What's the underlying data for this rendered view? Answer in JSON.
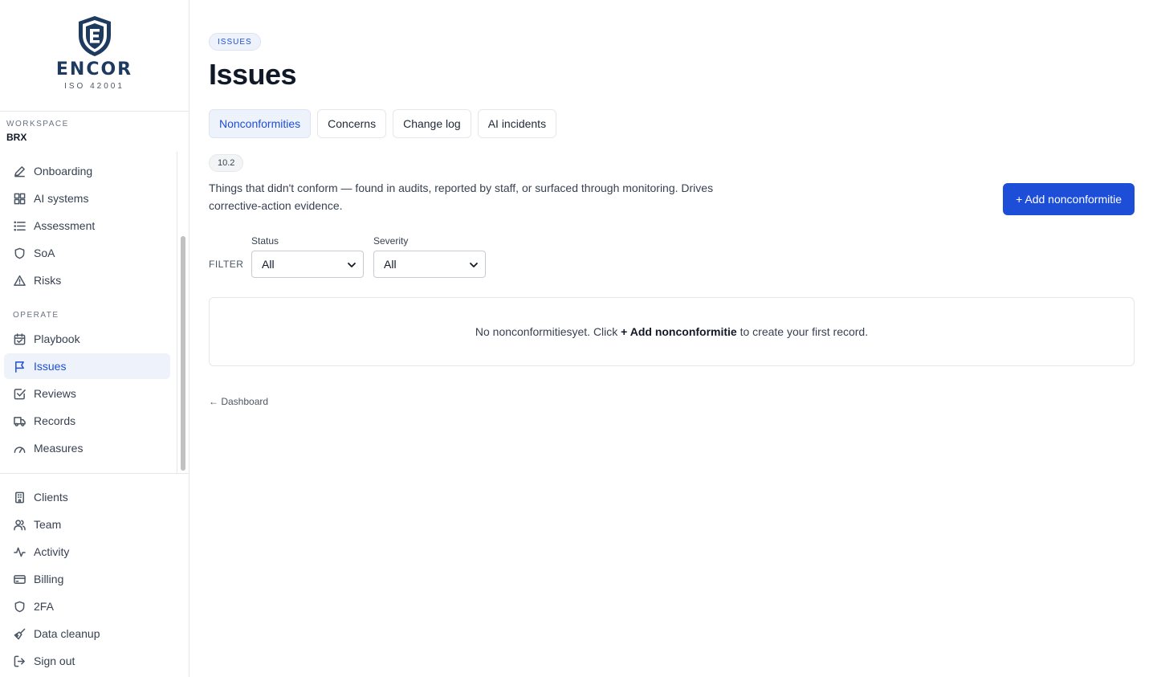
{
  "brand": {
    "name": "ENCOR",
    "subtitle": "ISO 42001"
  },
  "workspace": {
    "label": "WORKSPACE",
    "value": "BRX"
  },
  "nav": {
    "primary": [
      {
        "label": "Onboarding",
        "icon": "pen-icon"
      },
      {
        "label": "AI systems",
        "icon": "grid-icon"
      },
      {
        "label": "Assessment",
        "icon": "list-icon"
      },
      {
        "label": "SoA",
        "icon": "shield-icon"
      },
      {
        "label": "Risks",
        "icon": "warning-icon"
      }
    ],
    "operate_label": "OPERATE",
    "operate": [
      {
        "label": "Playbook",
        "icon": "calendar-icon"
      },
      {
        "label": "Issues",
        "icon": "flag-icon",
        "active": true
      },
      {
        "label": "Reviews",
        "icon": "checkbox-icon"
      },
      {
        "label": "Records",
        "icon": "truck-icon"
      },
      {
        "label": "Measures",
        "icon": "gauge-icon"
      }
    ],
    "bottom": [
      {
        "label": "Clients",
        "icon": "building-icon"
      },
      {
        "label": "Team",
        "icon": "users-icon"
      },
      {
        "label": "Activity",
        "icon": "activity-icon"
      },
      {
        "label": "Billing",
        "icon": "card-icon"
      },
      {
        "label": "2FA",
        "icon": "shield-icon"
      },
      {
        "label": "Data cleanup",
        "icon": "broom-icon"
      },
      {
        "label": "Sign out",
        "icon": "sign-out-icon"
      }
    ]
  },
  "page": {
    "breadcrumb": "ISSUES",
    "title": "Issues",
    "tabs": [
      "Nonconformities",
      "Concerns",
      "Change log",
      "AI incidents"
    ],
    "active_tab": "Nonconformities",
    "clause": "10.2",
    "description": "Things that didn't conform — found in audits, reported by staff, or surfaced through monitoring. Drives corrective-action evidence.",
    "add_button": "+ Add nonconformitie",
    "filter": {
      "label": "FILTER",
      "status_label": "Status",
      "status_value": "All",
      "severity_label": "Severity",
      "severity_value": "All"
    },
    "empty": {
      "prefix": "No nonconformitiesyet. Click ",
      "action": "+ Add nonconformitie",
      "suffix": " to create your first record."
    },
    "back_link": "← Dashboard"
  },
  "colors": {
    "accent": "#1d4ed8",
    "active_bg": "#eef2fb",
    "brand": "#1e3a5f"
  }
}
